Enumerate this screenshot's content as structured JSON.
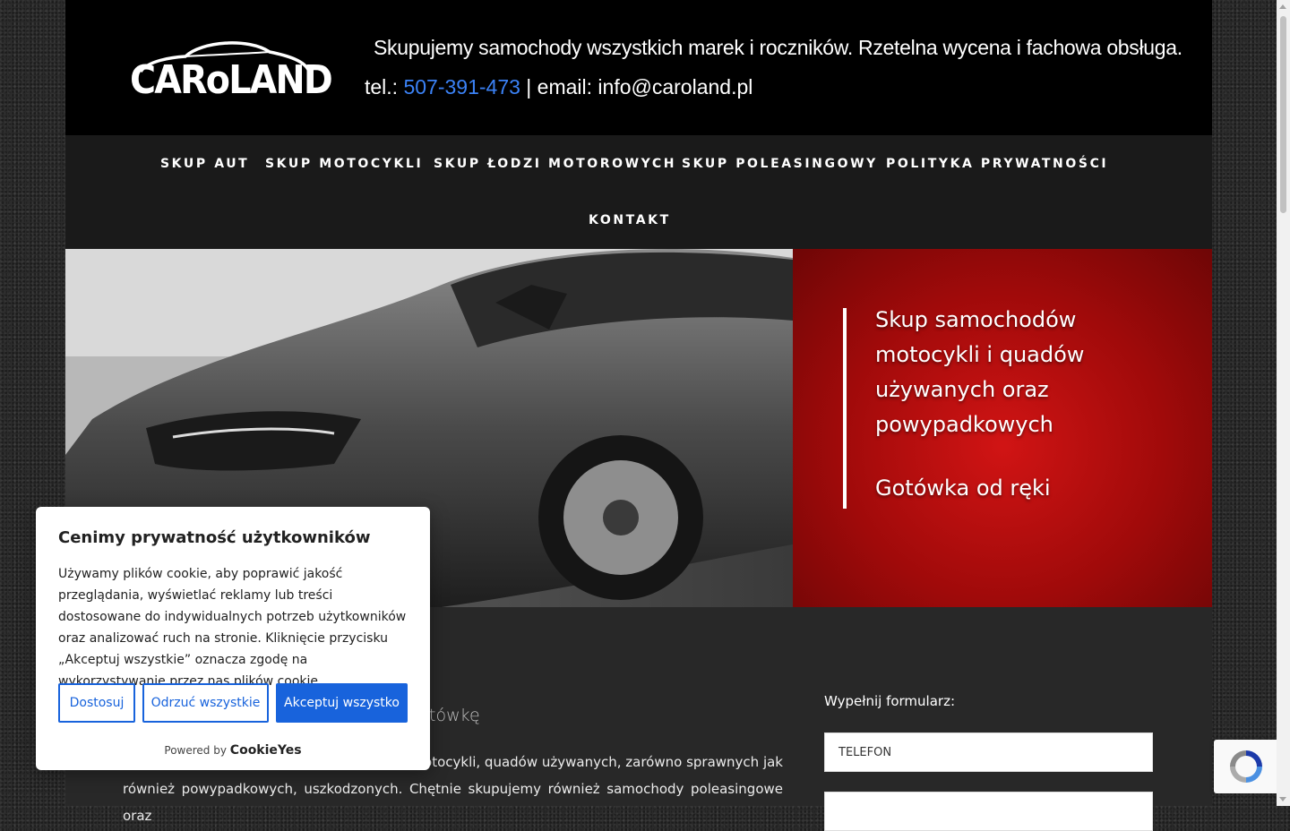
{
  "header": {
    "logo_text": "CARoLAND",
    "tagline": "Skupujemy samochody wszystkich marek i roczników. Rzetelna wycena i fachowa obsługa.",
    "tel_label": "tel.: ",
    "phone": "507-391-473",
    "email_sep": " | email: ",
    "email": "info@caroland.pl"
  },
  "nav": {
    "items": [
      {
        "label": "SKUP AUT"
      },
      {
        "label": "SKUP MOTOCYKLI"
      },
      {
        "label": "SKUP ŁODZI MOTOROWYCH"
      },
      {
        "label": "SKUP POLEASINGOWY"
      },
      {
        "label": "POLITYKA PRYWATNOŚCI"
      },
      {
        "label": "KONTAKT"
      }
    ]
  },
  "hero": {
    "lines": [
      "Skup samochodów",
      "motocykli i quadów",
      "używanych oraz",
      "powypadkowych"
    ],
    "cash": "Gotówka od ręki"
  },
  "content": {
    "subheading_tail": "tówkę",
    "paragraph_line1_tail": "motocykli, quadów używanych, zarówno sprawnych jak",
    "paragraph_line2": "również powypadkowych, uszkodzonych. Chętnie skupujemy również samochody poleasingowe oraz",
    "form_label": "Wypełnij formularz:",
    "field_phone_placeholder": "TELEFON"
  },
  "cookie": {
    "title": "Cenimy prywatność użytkowników",
    "body": "Używamy plików cookie, aby poprawić jakość przeglądania, wyświetlać reklamy lub treści dostosowane do indywidualnych potrzeb użytkowników oraz analizować ruch na stronie. Kliknięcie przycisku „Akceptuj wszystkie” oznacza zgodę na wykorzystywanie przez nas plików cookie.",
    "btn_customize": "Dostosuj",
    "btn_reject": "Odrzuć wszystkie",
    "btn_accept": "Akceptuj wszystko",
    "powered_by": "Powered by",
    "brand": "CookieYes"
  },
  "colors": {
    "accent_blue": "#1863dc",
    "phone_link": "#3b82f6",
    "hero_red": "#c20d0d"
  }
}
